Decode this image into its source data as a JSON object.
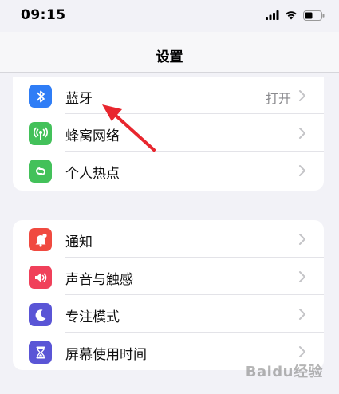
{
  "status_bar": {
    "time": "09:15"
  },
  "nav": {
    "title": "设置"
  },
  "groups": [
    {
      "items": [
        {
          "label": "蓝牙",
          "value": "打开",
          "icon": "bluetooth-icon",
          "color": "#2f7df6"
        },
        {
          "label": "蜂窝网络",
          "value": "",
          "icon": "cellular-antenna-icon",
          "color": "#43c15a"
        },
        {
          "label": "个人热点",
          "value": "",
          "icon": "personal-hotspot-icon",
          "color": "#43c15a"
        }
      ]
    },
    {
      "items": [
        {
          "label": "通知",
          "value": "",
          "icon": "notification-bell-icon",
          "color": "#f04a40"
        },
        {
          "label": "声音与触感",
          "value": "",
          "icon": "speaker-icon",
          "color": "#f0405a"
        },
        {
          "label": "专注模式",
          "value": "",
          "icon": "moon-icon",
          "color": "#5a55d6"
        },
        {
          "label": "屏幕使用时间",
          "value": "",
          "icon": "hourglass-icon",
          "color": "#5a55d6"
        }
      ]
    }
  ],
  "annotation": {
    "arrow_color": "#e8262e"
  },
  "watermark": {
    "text": "Baidu经验"
  }
}
